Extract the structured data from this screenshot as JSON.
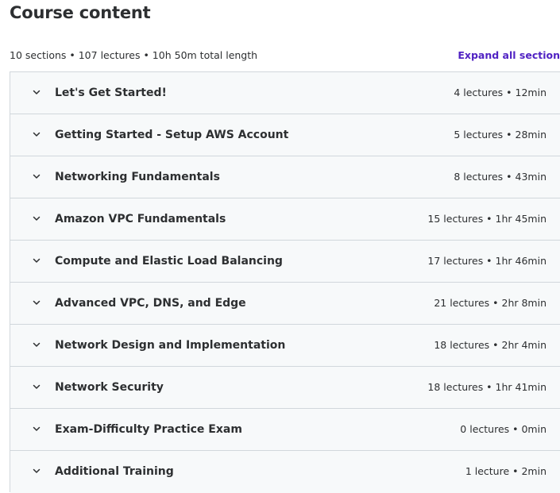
{
  "header": {
    "title": "Course content"
  },
  "summary": {
    "text": "10 sections • 107 lectures • 10h 50m total length",
    "expand_label": "Expand all section"
  },
  "colors": {
    "accent": "#5022c3",
    "text": "#2d2f31",
    "row_background": "#f7f9fa",
    "border": "#d1d7dc"
  },
  "sections": [
    {
      "title": "Let's Get Started!",
      "meta": "4 lectures • 12min",
      "icon": "chevron-down-icon"
    },
    {
      "title": "Getting Started - Setup AWS Account",
      "meta": "5 lectures • 28min",
      "icon": "chevron-down-icon"
    },
    {
      "title": "Networking Fundamentals",
      "meta": "8 lectures • 43min",
      "icon": "chevron-down-icon"
    },
    {
      "title": "Amazon VPC Fundamentals",
      "meta": "15 lectures • 1hr 45min",
      "icon": "chevron-down-icon"
    },
    {
      "title": "Compute and Elastic Load Balancing",
      "meta": "17 lectures • 1hr 46min",
      "icon": "chevron-down-icon"
    },
    {
      "title": "Advanced VPC, DNS, and Edge",
      "meta": "21 lectures • 2hr 8min",
      "icon": "chevron-down-icon"
    },
    {
      "title": "Network Design and Implementation",
      "meta": "18 lectures • 2hr 4min",
      "icon": "chevron-down-icon"
    },
    {
      "title": "Network Security",
      "meta": "18 lectures • 1hr 41min",
      "icon": "chevron-down-icon"
    },
    {
      "title": "Exam-Difficulty Practice Exam",
      "meta": "0 lectures • 0min",
      "icon": "chevron-down-icon"
    },
    {
      "title": "Additional Training",
      "meta": "1 lecture • 2min",
      "icon": "chevron-down-icon"
    }
  ]
}
